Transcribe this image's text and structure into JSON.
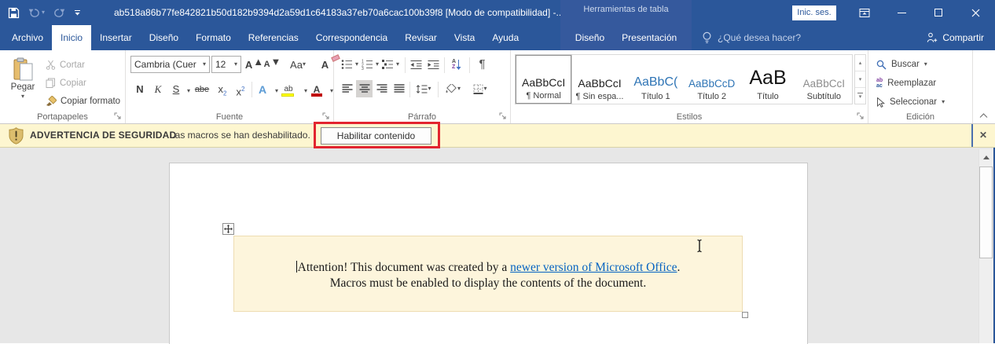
{
  "colors": {
    "titlebar_blue": "#2b579a",
    "contextual_panel_blue": "#35599d",
    "ribbon_bg": "#ffffff",
    "warning_bg": "#fdf6d0",
    "annotation_red": "#e2242f",
    "link_blue": "#0563c1",
    "textbox_bg": "#fdf5dc",
    "document_bg": "#e7e7e7"
  },
  "titlebar": {
    "title": "ab518a86b77fe842821b50d182b9394d2a59d1c64183a37eb70a6cac100b39f8 [Modo de compatibilidad] -...",
    "contextual_header": "Herramientas de tabla",
    "signin": "Inic. ses."
  },
  "tabs": {
    "file": "Archivo",
    "main": [
      "Inicio",
      "Insertar",
      "Diseño",
      "Formato",
      "Referencias",
      "Correspondencia",
      "Revisar",
      "Vista",
      "Ayuda"
    ],
    "contextual": [
      "Diseño",
      "Presentación"
    ],
    "tell_me": "¿Qué desea hacer?",
    "share": "Compartir"
  },
  "ribbon": {
    "clipboard": {
      "label": "Portapapeles",
      "paste": "Pegar",
      "cut": "Cortar",
      "copy": "Copiar",
      "format_painter": "Copiar formato"
    },
    "font": {
      "label": "Fuente",
      "name": "Cambria (Cuer",
      "size": "12",
      "bold": "N",
      "italic": "K",
      "underline": "S",
      "strike": "abe",
      "sub_x": "x",
      "sub_2": "2",
      "sup_x": "x",
      "sup_2": "2",
      "case": "Aa",
      "grow": "A",
      "shrink": "A",
      "clear": "A",
      "effects": "A",
      "highlight": "ab",
      "color": "A"
    },
    "paragraph": {
      "label": "Párrafo",
      "sort_a": "A",
      "sort_z": "Z",
      "pilcrow": "¶"
    },
    "styles": {
      "label": "Estilos",
      "items": [
        {
          "sample": "AaBbCcI",
          "name": "¶ Normal"
        },
        {
          "sample": "AaBbCcI",
          "name": "¶ Sin espa..."
        },
        {
          "sample": "AaBbC(",
          "name": "Título 1"
        },
        {
          "sample": "AaBbCcD",
          "name": "Título 2"
        },
        {
          "sample": "AaB",
          "name": "Título"
        },
        {
          "sample": "AaBbCcI",
          "name": "Subtítulo"
        }
      ]
    },
    "editing": {
      "label": "Edición",
      "find": "Buscar",
      "replace": "Reemplazar",
      "select": "Seleccionar"
    }
  },
  "message_bar": {
    "title": "ADVERTENCIA DE SEGURIDAD",
    "message": "Las macros se han deshabilitado.",
    "button": "Habilitar contenido",
    "close": "✕"
  },
  "document": {
    "line1_prefix": "Attention! This document was created by a ",
    "line1_link": "newer version of Microsoft Office",
    "line1_suffix": ".",
    "line2": "Macros must be enabled to display the contents of the document."
  }
}
